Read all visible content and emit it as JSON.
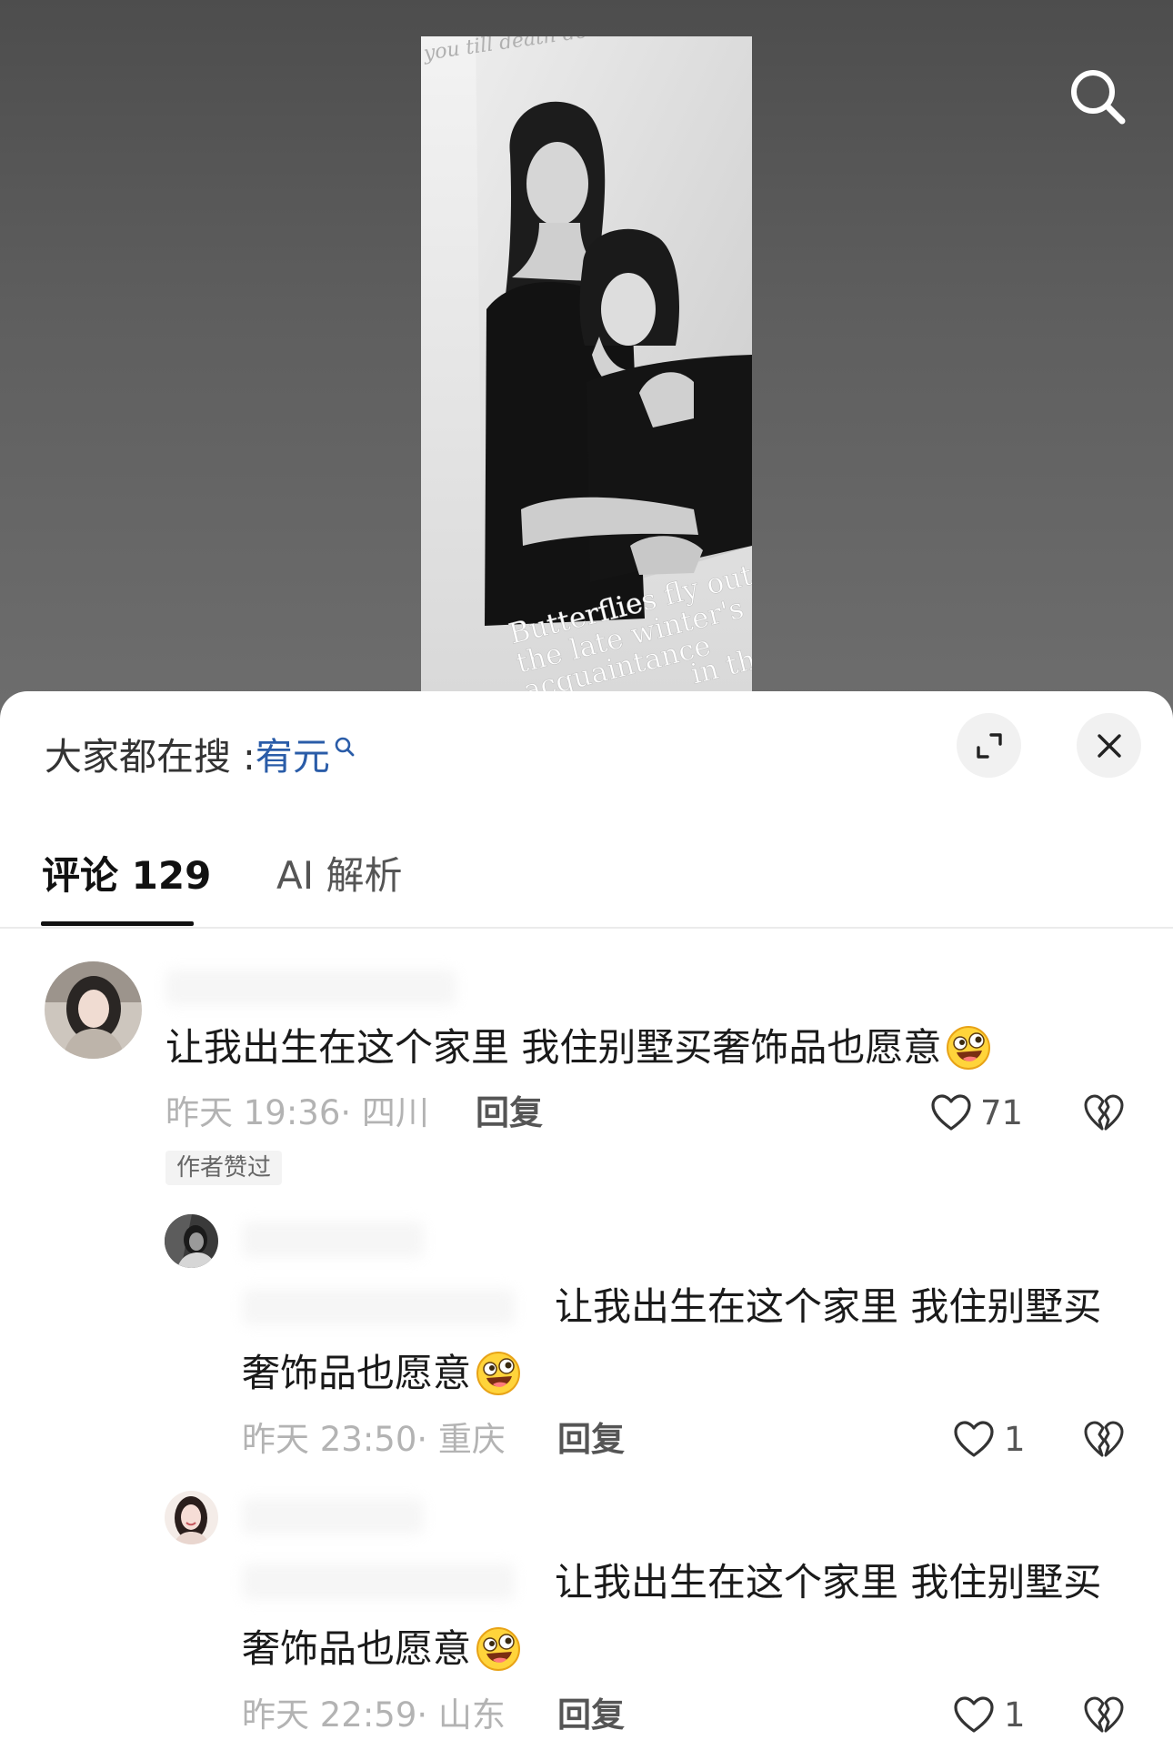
{
  "video": {
    "poster": {
      "script_text": "you till death do",
      "caption": [
        "Butterflies fly out",
        "the late winter's",
        "acquaintance",
        "in the"
      ]
    },
    "search_icon": "search-icon"
  },
  "sheet": {
    "hot_search": {
      "label": "大家都在搜 :",
      "keyword": "宥元",
      "keyword_icon": "search-icon"
    },
    "buttons": {
      "expand_icon": "expand-icon",
      "close_icon": "close-icon"
    },
    "tabs": [
      {
        "label": "评论",
        "count": "129",
        "active": true
      },
      {
        "label": "AI 解析",
        "active": false
      }
    ],
    "comments": [
      {
        "text": "让我出生在这个家里 我住别墅买奢饰品也愿意",
        "emoji": "grinning-squint-emoji",
        "meta": "昨天 19:36· 四川",
        "reply_label": "回复",
        "likes": "71",
        "badge": "作者赞过"
      },
      {
        "is_reply": true,
        "text_lines": [
          "让我出生在这个家里 我住别墅买",
          "奢饰品也愿意"
        ],
        "emoji": "grinning-squint-emoji",
        "meta": "昨天 23:50· 重庆",
        "reply_label": "回复",
        "likes": "1"
      },
      {
        "is_reply": true,
        "text_lines": [
          "让我出生在这个家里 我住别墅买",
          "奢饰品也愿意"
        ],
        "emoji": "grinning-squint-emoji",
        "meta": "昨天 22:59· 山东",
        "reply_label": "回复",
        "likes": "1"
      }
    ]
  },
  "colors": {
    "keyword_blue": "#2a5ca8",
    "meta_gray": "#b3b3b3",
    "video_background": "#5a5a5a",
    "sheet_background": "#ffffff"
  }
}
